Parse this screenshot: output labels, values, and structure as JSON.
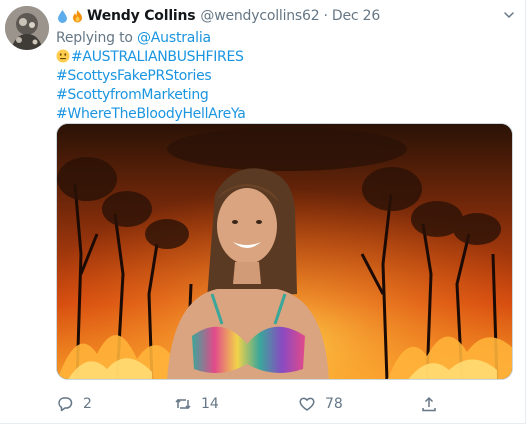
{
  "tweet": {
    "author": {
      "name": "Wendy Collins",
      "handle": "@wendycollins62",
      "badges": [
        "droplet-icon",
        "fire-icon"
      ]
    },
    "separator": "·",
    "date": "Dec 26",
    "reply": {
      "prefix": "Replying to",
      "target": "@Australia"
    },
    "lines": [
      {
        "emoji": "neutral-face-icon",
        "text": "#AUSTRALIANBUSHFIRES"
      },
      {
        "text": "#ScottysFakePRStories"
      },
      {
        "text": "#ScottyfromMarketing"
      },
      {
        "text": "#WhereTheBloodyHellAreYa"
      }
    ],
    "media": {
      "type": "image"
    },
    "actions": {
      "replies": "2",
      "retweets": "14",
      "likes": "78"
    }
  },
  "colors": {
    "link": "#1b95e0",
    "muted": "#657786",
    "text": "#14171a",
    "border": "#e6ecf0"
  }
}
